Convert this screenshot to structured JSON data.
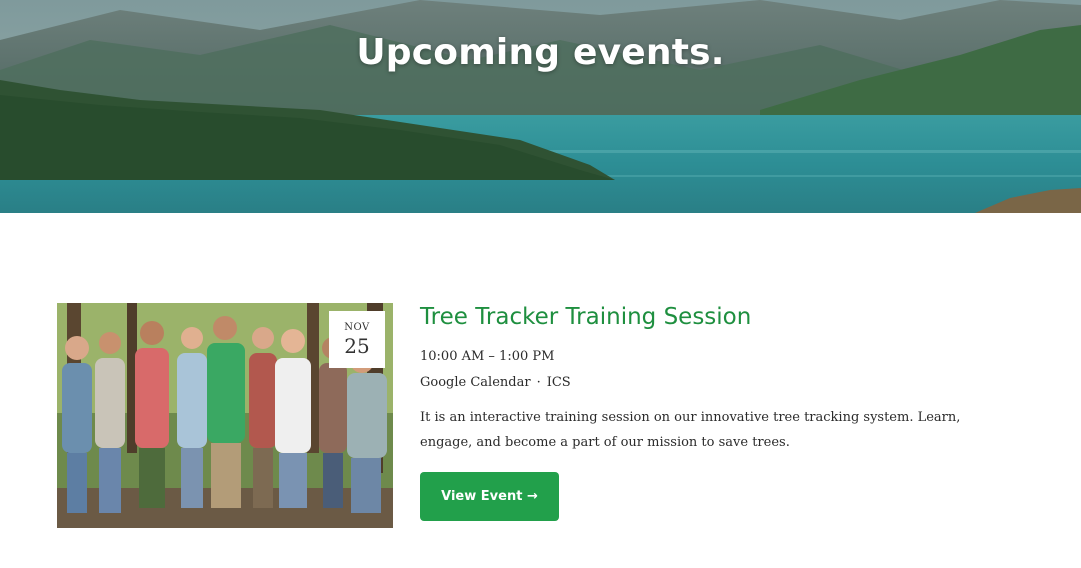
{
  "hero": {
    "title": "Upcoming events."
  },
  "event": {
    "title": "Tree Tracker Training Session",
    "date": {
      "month": "NOV",
      "day": "25"
    },
    "time": "10:00 AM – 1:00 PM",
    "calendar_links": [
      "Google Calendar",
      "ICS"
    ],
    "separator": "·",
    "description": "It is an interactive training session on our innovative tree tracking system. Learn, engage, and become a part of our mission to save trees.",
    "button_label": "View Event →"
  },
  "colors": {
    "title_green": "#1e8f3f",
    "button_green": "#22a04b",
    "lake_teal": "#2b8a90"
  }
}
